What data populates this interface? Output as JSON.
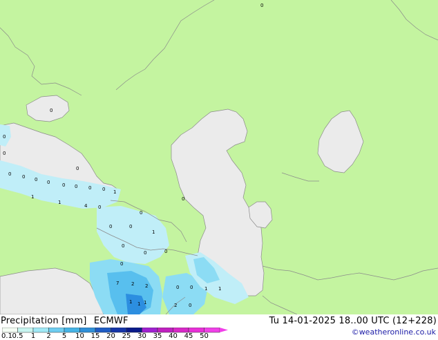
{
  "header": {
    "product": "Precipitation [mm]",
    "model": "ECMWF",
    "datetime": "Tu 14-01-2025 18..00 UTC (12+228)",
    "copyright": "©weatheronline.co.uk"
  },
  "legend": {
    "ticks": [
      "0.1",
      "0.5",
      "1",
      "2",
      "5",
      "10",
      "15",
      "20",
      "25",
      "30",
      "35",
      "40",
      "45",
      "50"
    ],
    "colors": [
      "#f5fff5",
      "#c8f5f0",
      "#a0e8f5",
      "#6ecdf0",
      "#46b4e6",
      "#2f8fd8",
      "#1f5cc4",
      "#1535a8",
      "#0a1a8a",
      "#a020d0",
      "#c020c0",
      "#d828c8",
      "#e830d8",
      "#f040e8"
    ]
  },
  "map_colors": {
    "land": "#c4f4a0",
    "sea": "#ebebeb",
    "border": "#8a8a8a",
    "precip_light": "#c0eef8",
    "precip_mid": "#8cdcf4",
    "precip_high": "#58bfee",
    "precip_heavy": "#2c8ee0"
  },
  "labels": [
    "0",
    "0",
    "0",
    "0",
    "0",
    "0",
    "0",
    "0",
    "0",
    "0",
    "0",
    "0",
    "1",
    "1",
    "1",
    "4",
    "0",
    "0",
    "0",
    "1",
    "0",
    "0",
    "0",
    "0",
    "0",
    "0",
    "7",
    "2",
    "2",
    "1",
    "1",
    "1",
    "0",
    "0",
    "1",
    "1",
    "2",
    "0",
    "0"
  ]
}
